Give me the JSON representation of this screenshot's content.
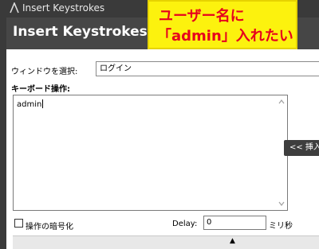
{
  "window": {
    "title": "Insert Keystrokes",
    "dialog_title": "Insert Keystrokes"
  },
  "annotation": {
    "line1": "ユーザー名に",
    "line2": "「admin」入れたい",
    "text_color": "#e6001e",
    "background": "#fcf20e"
  },
  "form": {
    "window_select_label": "ウィンドウを選択:",
    "window_select_value": "ログイン",
    "keyboard_label": "キーボード操作:",
    "keyboard_text": "admin",
    "encrypt_label": "操作の暗号化",
    "delay_label": "Delay:",
    "delay_value": "0",
    "delay_unit": "ミリ秒"
  },
  "buttons": {
    "insert_label": "<< 挿入"
  },
  "icons": {
    "app": "app-logo-icon",
    "scroll_up": "chevron-up-icon",
    "scroll_down": "chevron-down-icon",
    "expand": "triangle-up-icon"
  }
}
